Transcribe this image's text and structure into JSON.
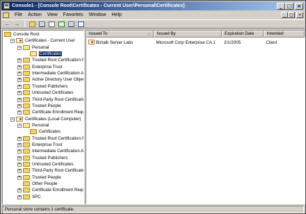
{
  "window": {
    "title": "Console1 - [Console Root\\Certificates - Current User\\Personal\\Certificates]",
    "min_glyph": "_",
    "max_glyph": "□",
    "close_glyph": "×"
  },
  "menu": {
    "items": [
      "File",
      "Action",
      "View",
      "Favorites",
      "Window",
      "Help"
    ]
  },
  "toolbar": {
    "back_glyph": "←",
    "forward_glyph": "→"
  },
  "tree": {
    "items": [
      {
        "label": "Console Root",
        "icon": "folder-icon"
      },
      {
        "label": "Certificates - Current User",
        "icon": "certificates-snapin-icon"
      },
      {
        "label": "Personal",
        "icon": "folder-open-icon"
      },
      {
        "label": "Certificates",
        "icon": "folder-open-icon"
      },
      {
        "label": "Trusted Root Certification Aut",
        "icon": "folder-icon"
      },
      {
        "label": "Enterprise Trust",
        "icon": "folder-icon"
      },
      {
        "label": "Intermediate Certification Aut",
        "icon": "folder-icon"
      },
      {
        "label": "Active Directory User Object",
        "icon": "folder-icon"
      },
      {
        "label": "Trusted Publishers",
        "icon": "folder-icon"
      },
      {
        "label": "Untrusted Certificates",
        "icon": "folder-icon"
      },
      {
        "label": "Third-Party Root Certification",
        "icon": "folder-icon"
      },
      {
        "label": "Trusted People",
        "icon": "folder-icon"
      },
      {
        "label": "Certificate Enrollment Reques",
        "icon": "folder-icon"
      },
      {
        "label": "Certificates (Local Computer)",
        "icon": "certificates-snapin-icon"
      },
      {
        "label": "Personal",
        "icon": "folder-open-icon"
      },
      {
        "label": "Certificates",
        "icon": "folder-icon"
      },
      {
        "label": "Trusted Root Certification Aut",
        "icon": "folder-icon"
      },
      {
        "label": "Enterprise Trust",
        "icon": "folder-icon"
      },
      {
        "label": "Intermediate Certification Aut",
        "icon": "folder-icon"
      },
      {
        "label": "Trusted Publishers",
        "icon": "folder-icon"
      },
      {
        "label": "Untrusted Certificates",
        "icon": "folder-icon"
      },
      {
        "label": "Third-Party Root Certification",
        "icon": "folder-icon"
      },
      {
        "label": "Trusted People",
        "icon": "folder-icon"
      },
      {
        "label": "Other People",
        "icon": "folder-icon"
      },
      {
        "label": "Certificate Enrollment Reques",
        "icon": "folder-icon"
      },
      {
        "label": "SPC",
        "icon": "folder-icon"
      }
    ],
    "expander_plus": "+",
    "expander_minus": "−"
  },
  "list": {
    "columns": [
      "Issued To",
      "Issued By",
      "Expiration Date",
      "Intended"
    ],
    "sort_glyph": "△",
    "rows": [
      {
        "issued_to": "Biztalk Server Labs",
        "issued_by": "Microsoft Corp Enterprise CA 1",
        "expiration": "2/1/2005",
        "intended": "Client"
      }
    ]
  },
  "status": {
    "text": "Personal store contains 1 certificate."
  }
}
